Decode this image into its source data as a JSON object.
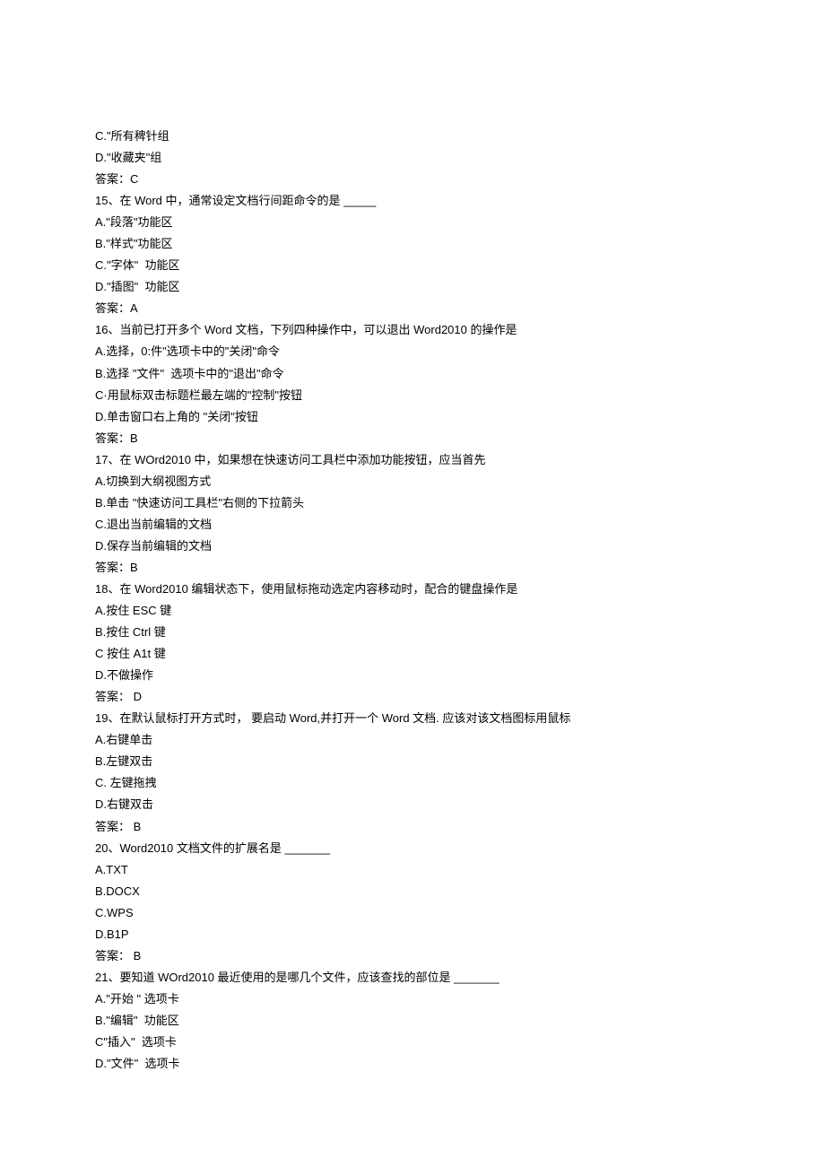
{
  "lines": [
    "C.\"所有稗针组",
    "D.\"收藏夹\"组",
    "答案：C",
    "15、在 Word 中，通常设定文档行间距命令的是 _____",
    "A.\"段落\"功能区",
    "B.\"样式\"功能区",
    "C.\"字体\"  功能区",
    "D.\"插图\"  功能区",
    "答案：A",
    "16、当前已打开多个 Word 文档，下列四种操作中，可以退出 Word2010 的操作是",
    "A.选择，0:件\"选项卡中的\"关闭\"命令",
    "B.选择 \"文件\"  选项卡中的\"退出\"命令",
    "C·用鼠标双击标题栏最左端的\"控制\"按钮",
    "D.单击窗口右上角的 \"关闭\"按钮",
    "答案：B",
    "17、在 WOrd2010 中，如果想在快速访问工具栏中添加功能按钮，应当首先",
    "A.切换到大纲视图方式",
    "B.单击 \"快速访问工具栏\"右侧的下拉箭头",
    "C.退出当前编辑的文档",
    "D.保存当前编辑的文档",
    "答案：B",
    "18、在 Word2010 编辑状态下，使用鼠标拖动选定内容移动时，配合的键盘操作是",
    "A.按住 ESC 键",
    "B.按住 Ctrl 键",
    "C 按住 A1t 键",
    "D.不做操作",
    "答案： D",
    "19、在默认鼠标打开方式时， 要启动 Word,并打开一个 Word 文档. 应该对该文档图标用鼠标",
    "A.右键单击",
    "B.左键双击",
    "C. 左键拖拽",
    "D.右键双击",
    "答案： B",
    "20、Word2010 文档文件的扩展名是 _______",
    "A.TXT",
    "B.DOCX",
    "C.WPS",
    "D.B1P",
    "答案： B",
    "21、要知道 WOrd2010 最近使用的是哪几个文件，应该查找的部位是 _______",
    "A.\"开始 \" 选项卡",
    "B.\"编辑\"  功能区",
    "C\"插入\"  选项卡",
    "D.\"文件\"  选项卡"
  ]
}
